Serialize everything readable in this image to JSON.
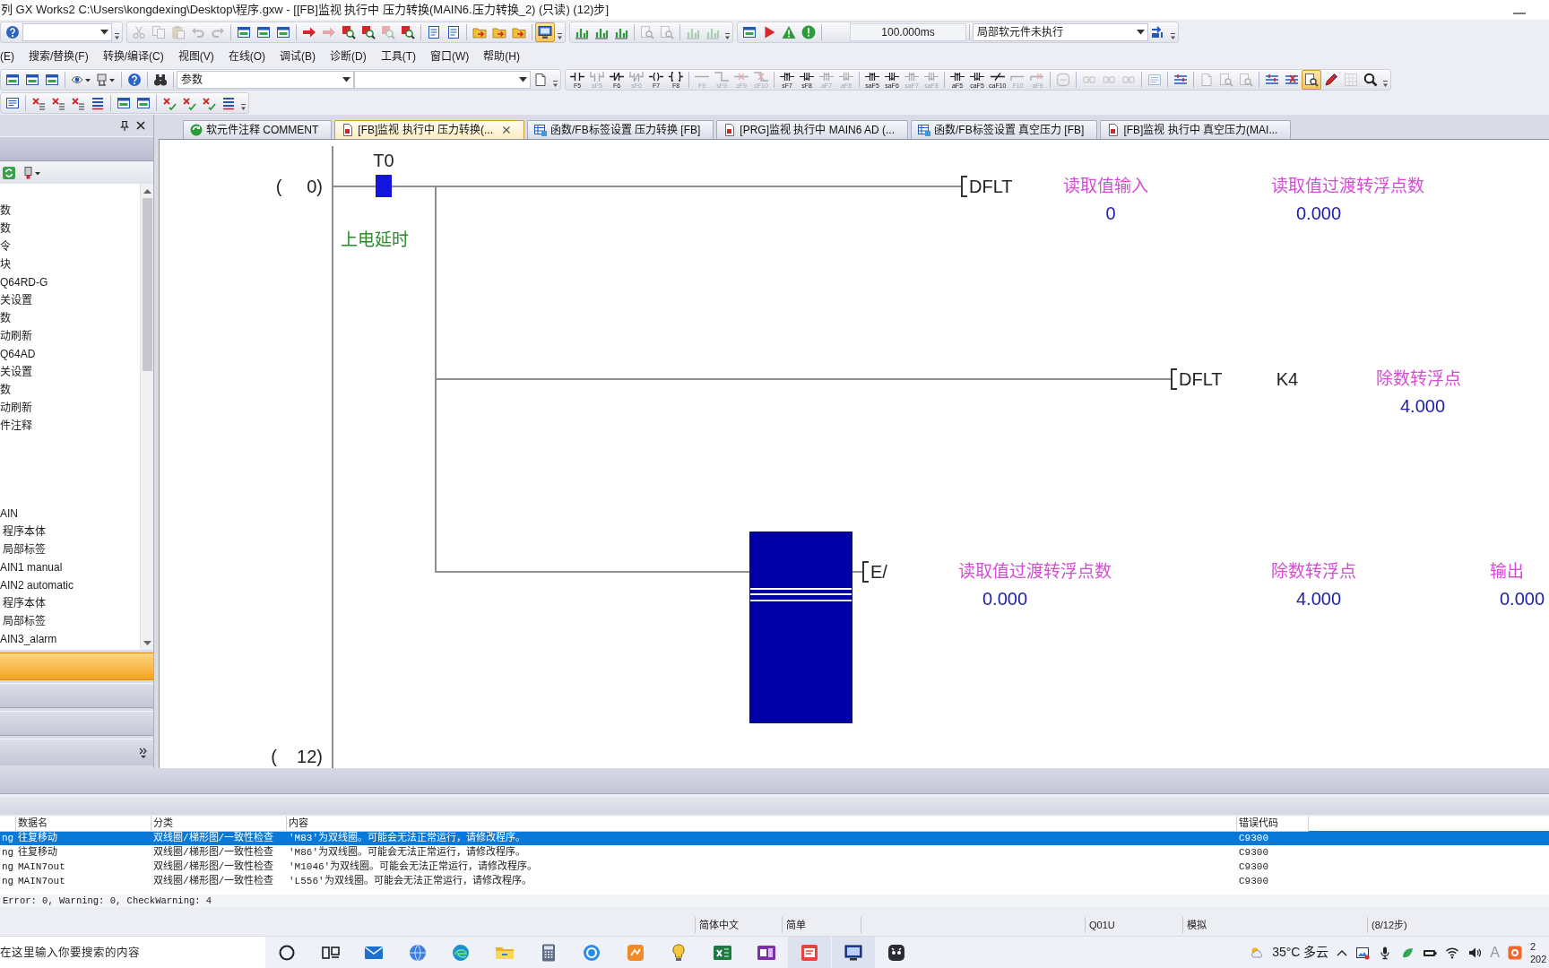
{
  "window": {
    "title": "列 GX Works2 C:\\Users\\kongdexing\\Desktop\\程序.gxw - [[FB]监视 执行中 压力转换(MAIN6.压力转换_2) (只读) (12)步]"
  },
  "toolbar_1": [
    {
      "groups": [
        [
          {
            "kind": "button",
            "disabled": false,
            "pressed": false
          },
          {
            "kind": "combo"
          }
        ]
      ]
    },
    {
      "groups": [
        [
          {
            "kind": "button",
            "disabled": true,
            "pressed": false
          },
          {
            "kind": "button",
            "disabled": true,
            "pressed": false
          },
          {
            "kind": "button",
            "disabled": true,
            "pressed": false
          },
          {
            "kind": "button",
            "disabled": true,
            "pressed": false
          },
          {
            "kind": "button",
            "disabled": true,
            "pressed": false
          }
        ],
        [
          {
            "kind": "button",
            "disabled": false,
            "pressed": false
          },
          {
            "kind": "button",
            "disabled": false,
            "pressed": false
          },
          {
            "kind": "button",
            "disabled": false,
            "pressed": false
          }
        ],
        [
          {
            "kind": "button",
            "disabled": false,
            "pressed": false
          },
          {
            "kind": "button",
            "disabled": true,
            "pressed": false
          },
          {
            "kind": "button",
            "disabled": false,
            "pressed": false
          },
          {
            "kind": "button",
            "disabled": false,
            "pressed": false
          },
          {
            "kind": "button",
            "disabled": true,
            "pressed": false
          },
          {
            "kind": "button",
            "disabled": false,
            "pressed": false
          }
        ],
        [
          {
            "kind": "button",
            "disabled": false,
            "pressed": false
          },
          {
            "kind": "button",
            "disabled": false,
            "pressed": false
          }
        ],
        [
          {
            "kind": "button",
            "disabled": false,
            "pressed": false
          },
          {
            "kind": "button",
            "disabled": false,
            "pressed": false
          },
          {
            "kind": "button",
            "disabled": false,
            "pressed": false
          }
        ],
        [
          {
            "kind": "button",
            "disabled": false,
            "pressed": true
          }
        ]
      ]
    },
    {
      "groups": [
        [
          {
            "kind": "button",
            "disabled": false,
            "pressed": false
          },
          {
            "kind": "button",
            "disabled": false,
            "pressed": false
          },
          {
            "kind": "button",
            "disabled": false,
            "pressed": false
          }
        ],
        [
          {
            "kind": "button",
            "disabled": true,
            "pressed": false
          },
          {
            "kind": "button",
            "disabled": true,
            "pressed": false
          }
        ],
        [
          {
            "kind": "button",
            "disabled": true,
            "pressed": false
          },
          {
            "kind": "button",
            "disabled": true,
            "pressed": false
          }
        ]
      ]
    },
    {
      "groups": [
        [
          {
            "kind": "button",
            "disabled": false,
            "pressed": false
          },
          {
            "kind": "button",
            "disabled": false,
            "pressed": false
          },
          {
            "kind": "button",
            "disabled": false,
            "pressed": false
          },
          {
            "kind": "button",
            "disabled": false,
            "pressed": false
          }
        ],
        [
          {
            "kind": "field",
            "value": "100.000ms"
          }
        ],
        [
          {
            "kind": "combo",
            "value": "局部软元件未执行"
          },
          {
            "kind": "button",
            "disabled": false,
            "pressed": false
          }
        ]
      ]
    }
  ],
  "menu": [
    "(E)",
    "搜索/替换(F)",
    "转换/编译(C)",
    "视图(V)",
    "在线(O)",
    "调试(B)",
    "诊断(D)",
    "工具(T)",
    "窗口(W)",
    "帮助(H)"
  ],
  "toolbar_2": [
    {
      "groups": [
        [
          {
            "kind": "button",
            "disabled": false,
            "pressed": false
          },
          {
            "kind": "button",
            "disabled": false,
            "pressed": false
          },
          {
            "kind": "button",
            "disabled": false,
            "pressed": false
          }
        ],
        [
          {
            "kind": "button",
            "disabled": false,
            "pressed": false
          },
          {
            "kind": "button",
            "disabled": false,
            "pressed": false
          }
        ],
        [
          {
            "kind": "button",
            "disabled": false,
            "pressed": false
          }
        ],
        [
          {
            "kind": "button",
            "disabled": false,
            "pressed": false
          }
        ],
        [
          {
            "kind": "combo",
            "value": "参数"
          },
          {
            "kind": "combo"
          },
          {
            "kind": "button",
            "disabled": false,
            "pressed": false
          }
        ]
      ]
    },
    {
      "groups": [
        [
          {
            "kind": "button",
            "label": "F5",
            "disabled": false,
            "pressed": false
          },
          {
            "kind": "button",
            "label": "sF5",
            "disabled": true,
            "pressed": false
          },
          {
            "kind": "button",
            "label": "F6",
            "disabled": false,
            "pressed": false
          },
          {
            "kind": "button",
            "label": "sF6",
            "disabled": true,
            "pressed": false
          },
          {
            "kind": "button",
            "label": "F7",
            "disabled": false,
            "pressed": false
          },
          {
            "kind": "button",
            "label": "F8",
            "disabled": false,
            "pressed": false
          }
        ],
        [
          {
            "kind": "button",
            "label": "F9",
            "disabled": true,
            "pressed": false
          },
          {
            "kind": "button",
            "label": "sF9",
            "disabled": true,
            "pressed": false
          },
          {
            "kind": "button",
            "label": "cF9",
            "disabled": true,
            "pressed": false
          },
          {
            "kind": "button",
            "label": "cF10",
            "disabled": true,
            "pressed": false
          }
        ],
        [
          {
            "kind": "button",
            "label": "sF7",
            "disabled": false,
            "pressed": false
          },
          {
            "kind": "button",
            "label": "sF8",
            "disabled": false,
            "pressed": false
          },
          {
            "kind": "button",
            "label": "aF7",
            "disabled": true,
            "pressed": false
          },
          {
            "kind": "button",
            "label": "aF8",
            "disabled": true,
            "pressed": false
          }
        ],
        [
          {
            "kind": "button",
            "label": "saF5",
            "disabled": false,
            "pressed": false
          },
          {
            "kind": "button",
            "label": "saF6",
            "disabled": false,
            "pressed": false
          },
          {
            "kind": "button",
            "label": "saF7",
            "disabled": true,
            "pressed": false
          },
          {
            "kind": "button",
            "label": "saF8",
            "disabled": true,
            "pressed": false
          }
        ],
        [
          {
            "kind": "button",
            "label": "aF5",
            "disabled": false,
            "pressed": false
          },
          {
            "kind": "button",
            "label": "caF5",
            "disabled": false,
            "pressed": false
          },
          {
            "kind": "button",
            "label": "caF10",
            "disabled": false,
            "pressed": false
          },
          {
            "kind": "button",
            "label": "F10",
            "disabled": true,
            "pressed": false
          },
          {
            "kind": "button",
            "label": "aF9",
            "disabled": true,
            "pressed": false
          }
        ],
        [
          {
            "kind": "button",
            "disabled": true,
            "pressed": false
          }
        ],
        [
          {
            "kind": "button",
            "disabled": true,
            "pressed": false
          },
          {
            "kind": "button",
            "disabled": true,
            "pressed": false
          },
          {
            "kind": "button",
            "disabled": true,
            "pressed": false
          }
        ],
        [
          {
            "kind": "button",
            "disabled": true,
            "pressed": false
          }
        ],
        [
          {
            "kind": "button",
            "disabled": false,
            "pressed": false
          }
        ],
        [
          {
            "kind": "button",
            "disabled": true,
            "pressed": false
          },
          {
            "kind": "button",
            "disabled": true,
            "pressed": false
          },
          {
            "kind": "button",
            "disabled": true,
            "pressed": false
          }
        ],
        [
          {
            "kind": "button",
            "disabled": false,
            "pressed": false
          },
          {
            "kind": "button",
            "disabled": false,
            "pressed": false
          },
          {
            "kind": "button",
            "disabled": false,
            "pressed": true
          },
          {
            "kind": "button",
            "disabled": false,
            "pressed": false
          },
          {
            "kind": "button",
            "disabled": true,
            "pressed": false
          },
          {
            "kind": "button",
            "disabled": false,
            "pressed": false
          }
        ]
      ]
    }
  ],
  "toolbar_3": [
    {
      "groups": [
        [
          {
            "kind": "button",
            "disabled": false,
            "pressed": false
          }
        ],
        [
          {
            "kind": "button",
            "disabled": false,
            "pressed": false
          },
          {
            "kind": "button",
            "disabled": false,
            "pressed": false
          },
          {
            "kind": "button",
            "disabled": false,
            "pressed": false
          },
          {
            "kind": "button",
            "disabled": false,
            "pressed": false
          }
        ],
        [
          {
            "kind": "button",
            "disabled": false,
            "pressed": false
          },
          {
            "kind": "button",
            "disabled": false,
            "pressed": false
          }
        ],
        [
          {
            "kind": "button",
            "disabled": false,
            "pressed": false
          },
          {
            "kind": "button",
            "disabled": false,
            "pressed": false
          },
          {
            "kind": "button",
            "disabled": false,
            "pressed": false
          },
          {
            "kind": "button",
            "disabled": false,
            "pressed": false
          }
        ]
      ]
    }
  ],
  "navigation": {
    "tree": [
      {
        "items": [
          {
            "label": "数"
          },
          {
            "label": "数"
          },
          {
            "label": "令"
          },
          {
            "label": "块"
          },
          {
            "label": "Q64RD-G"
          },
          {
            "label": "关设置"
          },
          {
            "label": "数"
          },
          {
            "label": "动刷新"
          },
          {
            "label": "Q64AD"
          },
          {
            "label": "关设置"
          },
          {
            "label": "数"
          },
          {
            "label": "动刷新"
          },
          {
            "label": "件注释"
          }
        ]
      },
      {
        "items": [
          {
            "label": "AIN",
            "children": [
              {
                "label": "程序本体"
              },
              {
                "label": "局部标签"
              }
            ]
          },
          {
            "label": "AIN1 manual"
          },
          {
            "label": "AIN2 automatic",
            "children": [
              {
                "label": "程序本体"
              },
              {
                "label": "局部标签"
              }
            ]
          },
          {
            "label": "AIN3_alarm"
          }
        ]
      }
    ],
    "panels": [
      {
        "selected": true
      },
      {
        "selected": false
      },
      {
        "selected": false
      }
    ]
  },
  "tabs": [
    {
      "label": "软元件注释 COMMENT",
      "kind": "comment",
      "selected": false
    },
    {
      "label": "[FB]监视 执行中 压力转换(...",
      "kind": "monitor",
      "selected": true
    },
    {
      "label": "函数/FB标签设置 压力转换 [FB]",
      "kind": "labels",
      "selected": false
    },
    {
      "label": "[PRG]监视 执行中 MAIN6 AD (...",
      "kind": "monitor",
      "selected": false
    },
    {
      "label": "函数/FB标签设置 真空压力 [FB]",
      "kind": "labels",
      "selected": false
    },
    {
      "label": "[FB]监视 执行中 真空压力(MAI...",
      "kind": "monitor",
      "selected": false
    }
  ],
  "ladder": {
    "rungs": [
      {
        "step": "(     0)",
        "contact": {
          "device": "T0",
          "on": true,
          "comment": "上电延时"
        },
        "branches": [
          {
            "instruction": "DFLT",
            "operands": [
              {
                "comment": "读取值输入",
                "value": "0"
              },
              {
                "comment": "读取值过渡转浮点数",
                "value": "0.000"
              }
            ]
          },
          {
            "instruction": "DFLT",
            "operands": [
              {
                "device": "K4"
              },
              {
                "comment": "除数转浮点",
                "value": "4.000"
              }
            ]
          },
          {
            "instruction": "E/",
            "operands": [
              {
                "comment": "读取值过渡转浮点数",
                "value": "0.000"
              },
              {
                "comment": "除数转浮点",
                "value": "4.000"
              },
              {
                "comment": "输出",
                "value": "0.000"
              }
            ]
          }
        ]
      },
      {
        "step": "(    12)"
      }
    ]
  },
  "output": {
    "columns": [
      "",
      "数据名",
      "分类",
      "内容",
      "错误代码"
    ],
    "rows": [
      {
        "selected": true,
        "cells": [
          "ng",
          "往复移动",
          "双线圈/梯形图/一致性检查",
          "'M83'为双线圈。可能会无法正常运行，请修改程序。",
          "C9300"
        ]
      },
      {
        "selected": false,
        "cells": [
          "ng",
          "往复移动",
          "双线圈/梯形图/一致性检查",
          "'M86'为双线圈。可能会无法正常运行，请修改程序。",
          "C9300"
        ]
      },
      {
        "selected": false,
        "cells": [
          "ng",
          "MAIN7out",
          "双线圈/梯形图/一致性检查",
          "'M1046'为双线圈。可能会无法正常运行，请修改程序。",
          "C9300"
        ]
      },
      {
        "selected": false,
        "cells": [
          "ng",
          "MAIN7out",
          "双线圈/梯形图/一致性检查",
          "'L556'为双线圈。可能会无法正常运行，请修改程序。",
          "C9300"
        ]
      }
    ],
    "summary": "Error: 0, Warning: 0, CheckWarning: 4"
  },
  "status_bar": [
    "简体中文",
    "简单",
    "Q01U",
    "模拟",
    "(8/12步)"
  ],
  "taskbar": {
    "search": {
      "placeholder": "在这里输入你要搜索的内容"
    },
    "apps": [
      {
        "active": false
      },
      {
        "active": false
      },
      {
        "active": false
      },
      {
        "active": false
      },
      {
        "active": false
      },
      {
        "active": false
      },
      {
        "active": false
      },
      {
        "active": false
      },
      {
        "active": false
      },
      {
        "active": false
      },
      {
        "active": false
      },
      {
        "active": false
      },
      {
        "active": true
      },
      {
        "active": true
      },
      {
        "active": false
      }
    ],
    "weather": "35°C 多云",
    "input_mode": "A",
    "clock": [
      "2",
      "202"
    ]
  }
}
